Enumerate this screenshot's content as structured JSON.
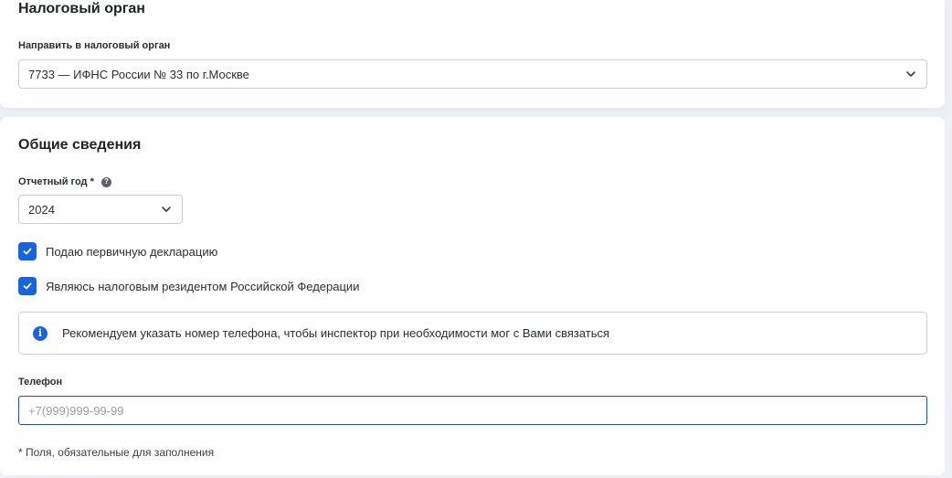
{
  "tax_authority": {
    "title": "Налоговый орган",
    "field_label": "Направить в налоговый орган",
    "selected_value": "7733 — ИФНС России № 33 по г.Москве"
  },
  "general": {
    "title": "Общие сведения",
    "year_label": "Отчетный год *",
    "year_help": "?",
    "year_value": "2024",
    "checkbox_primary": {
      "label": "Подаю первичную декларацию",
      "checked": true
    },
    "checkbox_resident": {
      "label": "Являюсь налоговым резидентом Российской Федерации",
      "checked": true
    },
    "info": {
      "icon": "info-icon",
      "text": "Рекомендуем указать номер телефона, чтобы инспектор при необходимости мог с Вами связаться"
    },
    "phone": {
      "label": "Телефон",
      "placeholder": "+7(999)999-99-99",
      "value": ""
    },
    "required_note": "* Поля, обязательные для заполнения"
  },
  "colors": {
    "accent": "#1565e0",
    "page_background": "#eef2f8",
    "input_focus_border": "#1f4fa3"
  }
}
